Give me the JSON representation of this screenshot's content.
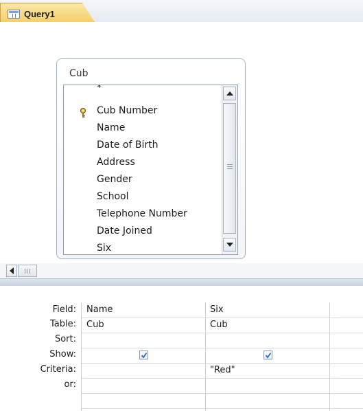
{
  "tab": {
    "label": "Query1",
    "icon": "query-table-icon"
  },
  "table_box": {
    "title": "Cub",
    "fields": [
      "*",
      "Cub Number",
      "Name",
      "Date of Birth",
      "Address",
      "Gender",
      "School",
      "Telephone Number",
      "Date Joined",
      "Six"
    ],
    "primary_key_field": "Cub Number"
  },
  "grid": {
    "row_labels": {
      "field": "Field:",
      "table": "Table:",
      "sort": "Sort:",
      "show": "Show:",
      "criteria": "Criteria:",
      "or": "or:"
    },
    "columns": [
      {
        "field": "Name",
        "table": "Cub",
        "sort": "",
        "show": true,
        "criteria": ""
      },
      {
        "field": "Six",
        "table": "Cub",
        "sort": "",
        "show": true,
        "criteria": "\"Red\""
      }
    ]
  },
  "colors": {
    "tab_bg": "#f6cf6a",
    "accent": "#7ea4d4",
    "check": "#2b6cc4"
  }
}
